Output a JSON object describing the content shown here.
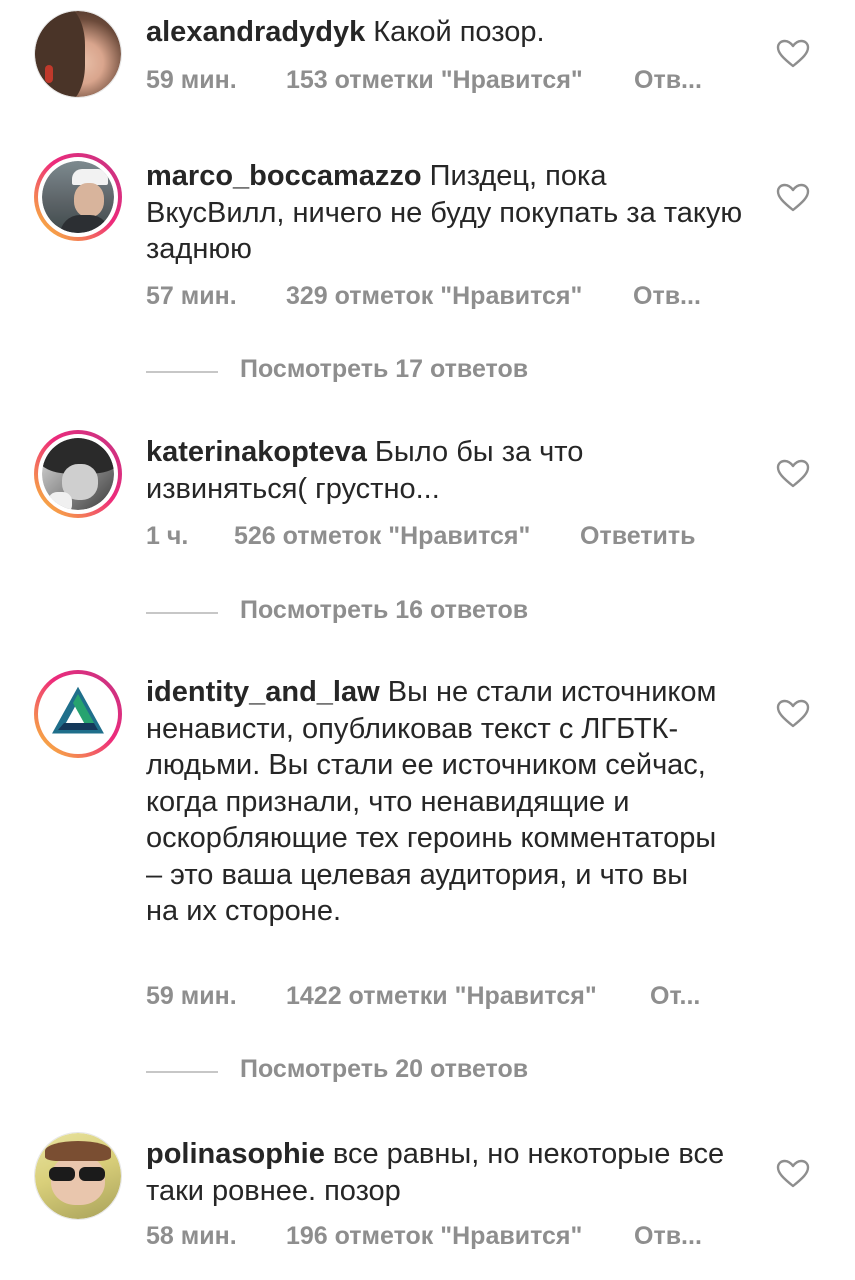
{
  "comments": [
    {
      "username": "alexandradydyk",
      "text": " Какой позор.",
      "time": "59 мин.",
      "likes": "153 отметки \"Нравится\"",
      "reply": "Отв..."
    },
    {
      "username": "marco_boccamazzo",
      "text": " Пиздец, пока ВкусВилл, ничего не буду покупать за такую заднюю",
      "time": "57 мин.",
      "likes": "329 отметок \"Нравится\"",
      "reply": "Отв..."
    },
    {
      "username": "katerinakopteva",
      "text": " Было бы за что извиняться( грустно...",
      "time": "1 ч.",
      "likes": "526 отметок \"Нравится\"",
      "reply": "Ответить"
    },
    {
      "username": "identity_and_law",
      "text": " Вы не стали источником ненависти, опубликовав текст с ЛГБТК-людьми. Вы стали ее источником сейчас, когда признали, что ненавидящие и оскорбляющие тех героинь комментаторы – это ваша целевая аудитория, и что вы на их стороне.",
      "time": "59 мин.",
      "likes": "1422 отметки \"Нравится\"",
      "reply": "От..."
    },
    {
      "username": "polinasophie",
      "text": " все равны, но некоторые все таки ровнее. позор",
      "time": "58 мин.",
      "likes": "196 отметок \"Нравится\"",
      "reply": "Отв..."
    }
  ],
  "view_replies": [
    "Посмотреть 17 ответов",
    "Посмотреть 16 ответов",
    "Посмотреть 20 ответов"
  ],
  "icons": {
    "heart": "heart-outline-icon",
    "avatar_logo": "triangle-logo-icon"
  },
  "colors": {
    "text": "#262626",
    "secondary": "#8e8e8e",
    "story_ring_start": "#f9ce34",
    "story_ring_end": "#c13584"
  }
}
